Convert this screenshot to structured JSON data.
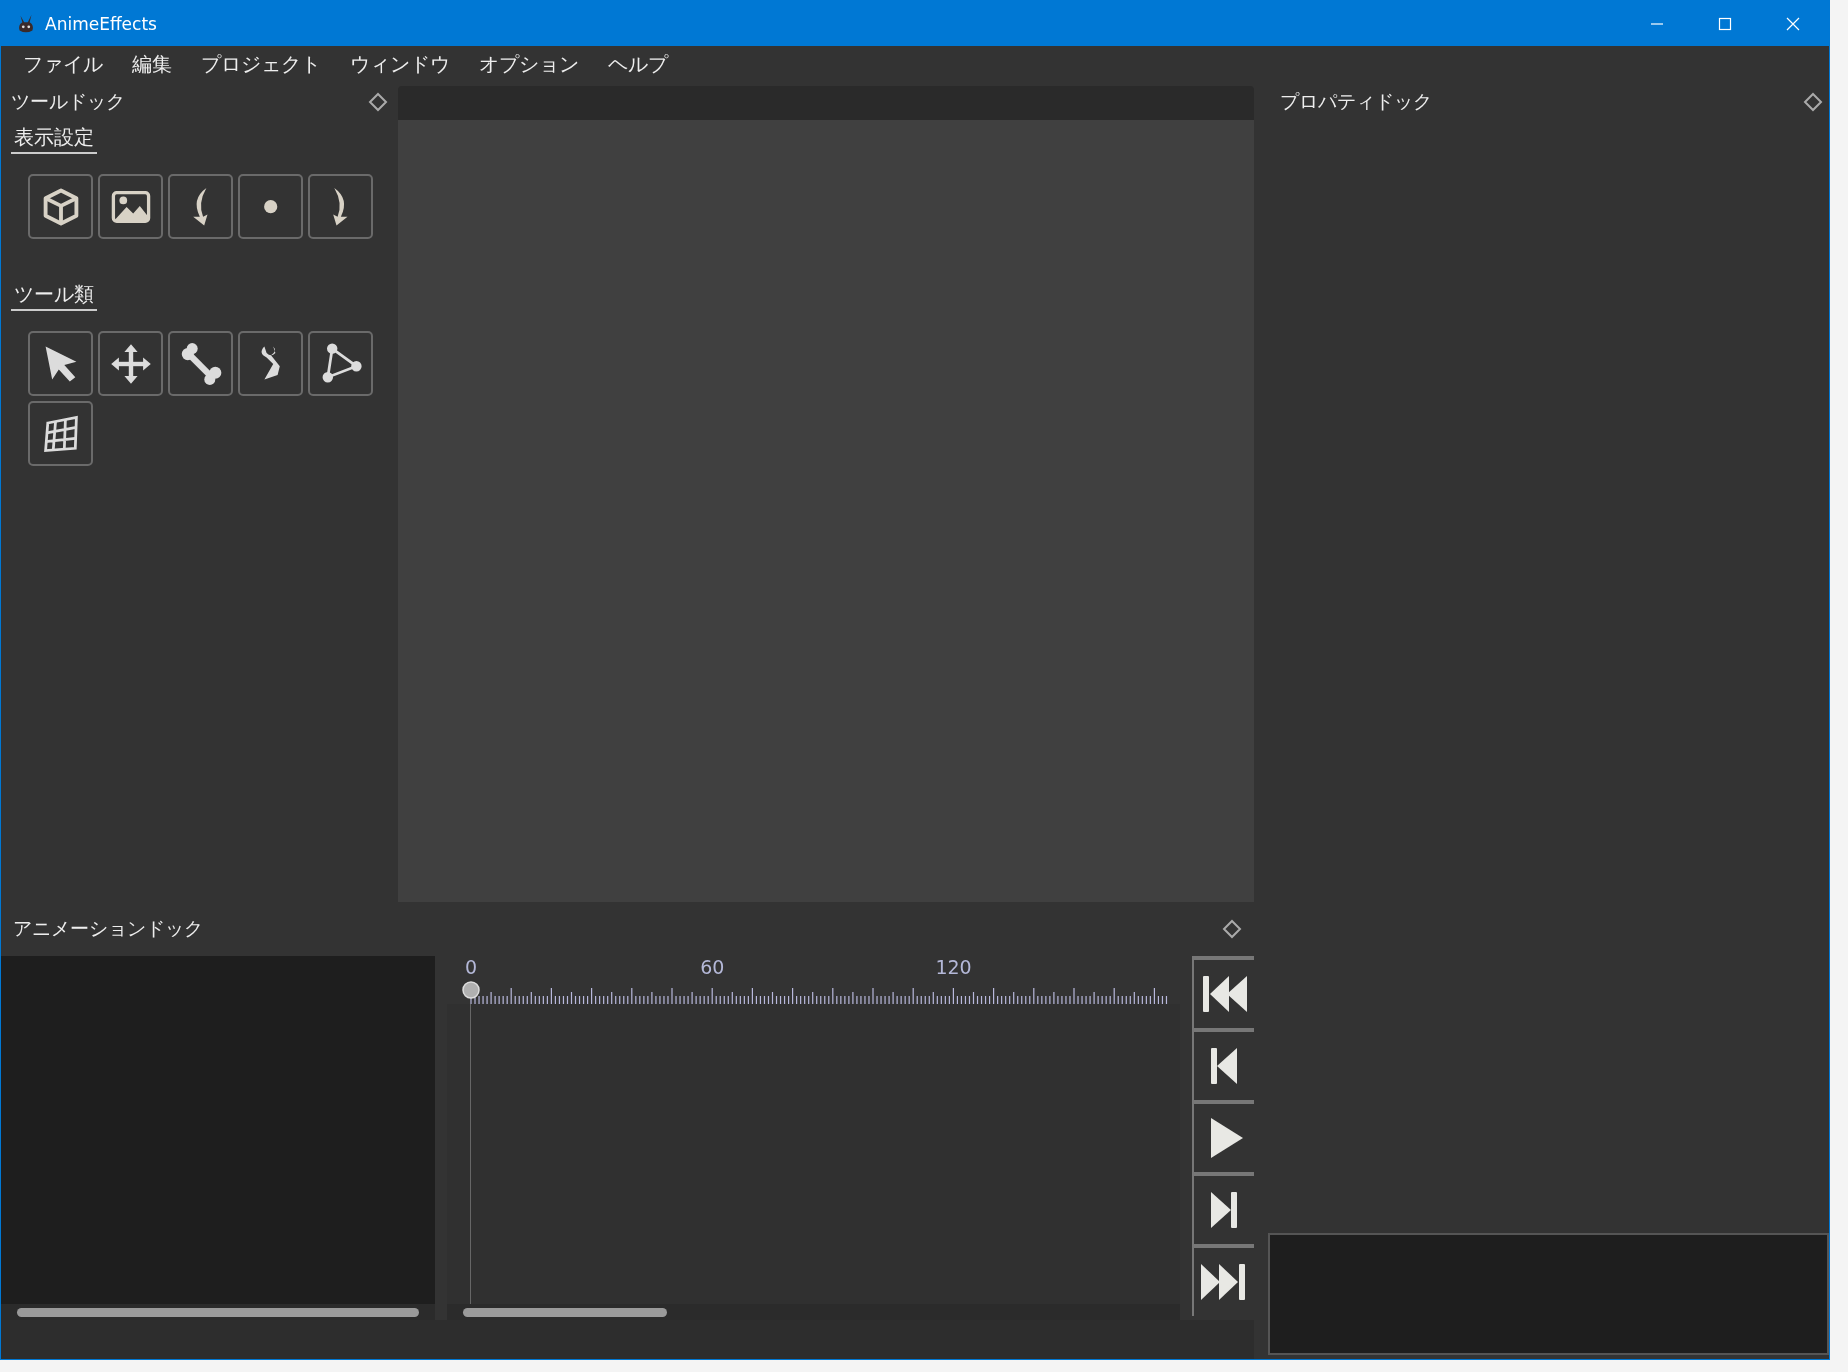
{
  "window": {
    "title": "AnimeEffects"
  },
  "menu": [
    "ファイル",
    "編集",
    "プロジェクト",
    "ウィンドウ",
    "オプション",
    "ヘルプ"
  ],
  "tool_dock": {
    "title": "ツールドック",
    "sections": [
      {
        "title": "表示設定"
      },
      {
        "title": "ツール類"
      }
    ]
  },
  "property_dock": {
    "title": "プロパティドック"
  },
  "animation_dock": {
    "title": "アニメーションドック",
    "ruler_labels": [
      "0",
      "60",
      "120"
    ]
  }
}
